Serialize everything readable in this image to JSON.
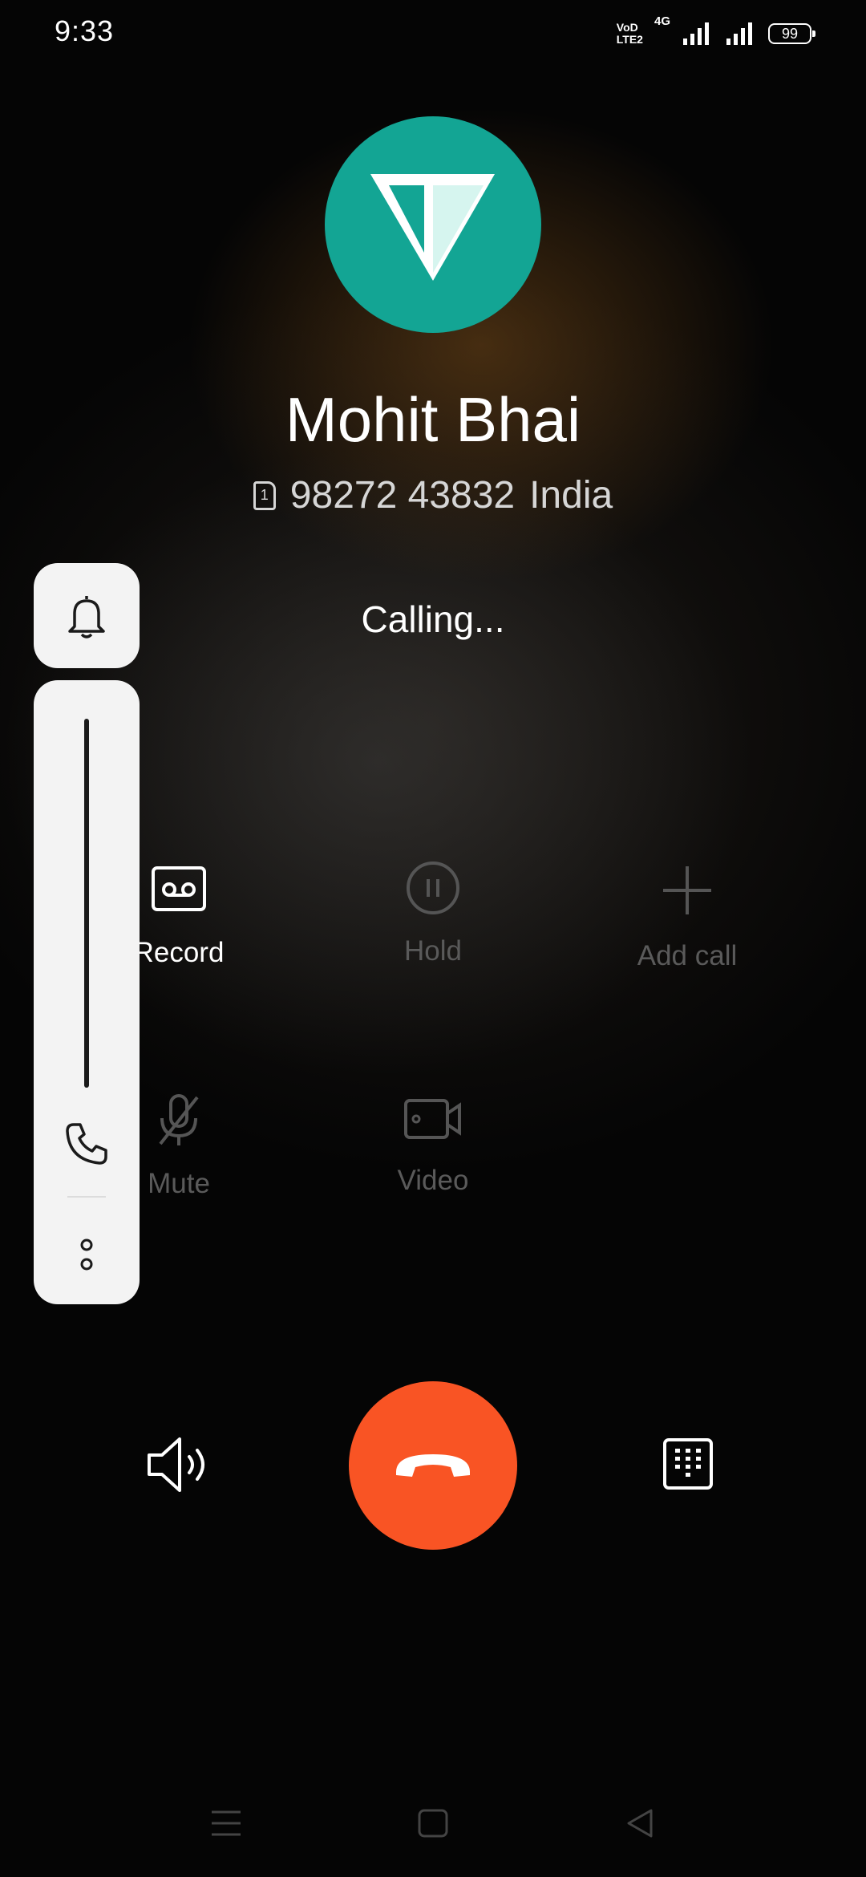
{
  "status_bar": {
    "time": "9:33",
    "volte_top": "VoD",
    "volte_bottom": "LTE2",
    "network_type": "4G",
    "battery": "99"
  },
  "contact": {
    "name": "Mohit Bhai",
    "sim_slot": "1",
    "number": "98272 43832",
    "location": "India"
  },
  "call_status": "Calling...",
  "actions": {
    "record": "Record",
    "hold": "Hold",
    "add_call": "Add call",
    "mute": "Mute",
    "video": "Video"
  },
  "colors": {
    "avatar_bg": "#13a594",
    "end_call": "#f95424",
    "panel_bg": "#f3f3f3"
  },
  "icons": {
    "ringer": "bell-icon",
    "volume_stream": "phone-icon",
    "more": "more-vertical-icon",
    "record": "voicemail-tape-icon",
    "hold": "pause-circle-icon",
    "add_call": "plus-icon",
    "mute": "mic-off-icon",
    "video": "video-camera-icon",
    "speaker": "speaker-icon",
    "end_call": "hang-up-icon",
    "keypad": "dialpad-icon",
    "nav_menu": "menu-icon",
    "nav_home": "home-icon",
    "nav_back": "back-icon"
  }
}
